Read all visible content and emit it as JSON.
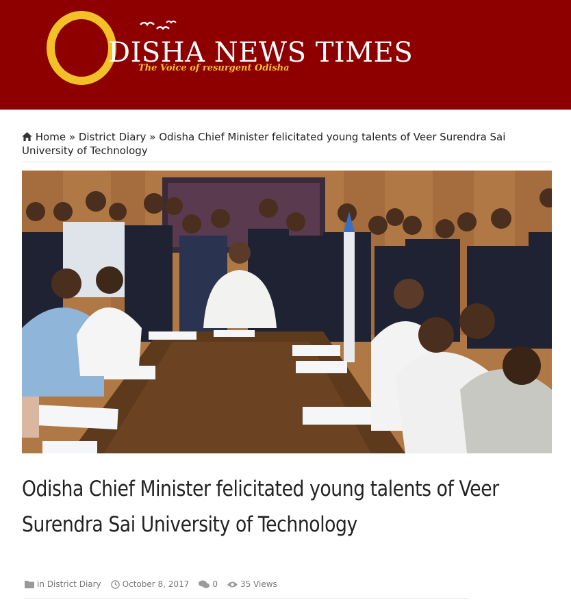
{
  "site": {
    "logo_letter": "O",
    "name": "DISHA NEWS TIMES",
    "tagline": "The Voice of resurgent Odisha",
    "colors": {
      "header_bg": "#8e0000",
      "logo_gold": "#f3c027"
    }
  },
  "breadcrumb": {
    "home_icon": "home-icon",
    "home": "Home",
    "separator": "»",
    "category": "District Diary",
    "current": "Odisha Chief Minister felicitated young talents of Veer Surendra Sai University of Technology"
  },
  "article": {
    "title": "Odisha Chief Minister felicitated young talents of Veer Surendra Sai University of Technology",
    "meta": {
      "category_icon": "folder-icon",
      "category_prefix": "in",
      "category": "District Diary",
      "date_icon": "clock-icon",
      "date": "October 8, 2017",
      "comments_icon": "comments-icon",
      "comments": "0",
      "views_icon": "eye-icon",
      "views": "35 Views"
    }
  }
}
